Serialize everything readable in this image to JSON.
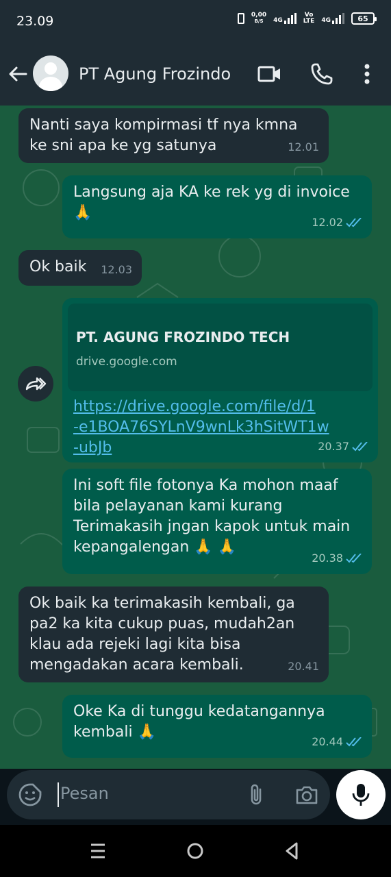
{
  "status_bar": {
    "time": "23.09",
    "net_speed_value": "0,00",
    "net_speed_unit": "B/S",
    "sim1_tech": "4G",
    "volte_label_top": "Vo",
    "volte_label_bottom": "LTE",
    "sim2_tech": "4G",
    "battery": "65"
  },
  "header": {
    "contact_name": "PT Agung Frozindo",
    "icons": [
      "back-arrow-icon",
      "avatar",
      "video-call-icon",
      "phone-icon",
      "more-vert-icon"
    ]
  },
  "messages": [
    {
      "direction": "in",
      "text": "Nanti saya kompirmasi tf nya kmna\nke sni apa ke yg satunya",
      "time": "12.01"
    },
    {
      "direction": "out",
      "text": "Langsung aja KA ke rek yg di invoice\n🙏",
      "time": "12.02",
      "status": "read"
    },
    {
      "direction": "in",
      "text": "Ok baik",
      "time": "12.03"
    },
    {
      "direction": "out",
      "link_title": "PT. AGUNG FROZINDO TECH",
      "link_domain": "drive.google.com",
      "text": "https://drive.google.com/file/d/1\n-e1BOA76SYLnV9wnLk3hSitWT1w\n-ubJb",
      "time": "20.37",
      "status": "read"
    },
    {
      "direction": "out",
      "text": "Ini soft file fotonya Ka mohon maaf\nbila pelayanan kami kurang\nTerimakasih jngan kapok untuk main\nkepangalengan 🙏 🙏",
      "time": "20.38",
      "status": "read"
    },
    {
      "direction": "in",
      "text": "Ok baik ka terimakasih kembali, ga\npa2 ka kita cukup puas, mudah2an\nklau ada rejeki lagi kita bisa\nmengadakan acara kembali.",
      "time": "20.41"
    },
    {
      "direction": "out",
      "text": "Oke Ka di tunggu kedatangannya\nkembali 🙏",
      "time": "20.44",
      "status": "read"
    }
  ],
  "composer": {
    "placeholder": "Pesan",
    "icons": [
      "emoji-sticker-icon",
      "attach-icon",
      "camera-icon",
      "mic-icon"
    ]
  },
  "colors": {
    "chat_bg": "#1a5c3e",
    "incoming": "#1f2c34",
    "outgoing": "#005c4b",
    "link": "#53bdeb",
    "read_tick": "#53bdeb"
  }
}
